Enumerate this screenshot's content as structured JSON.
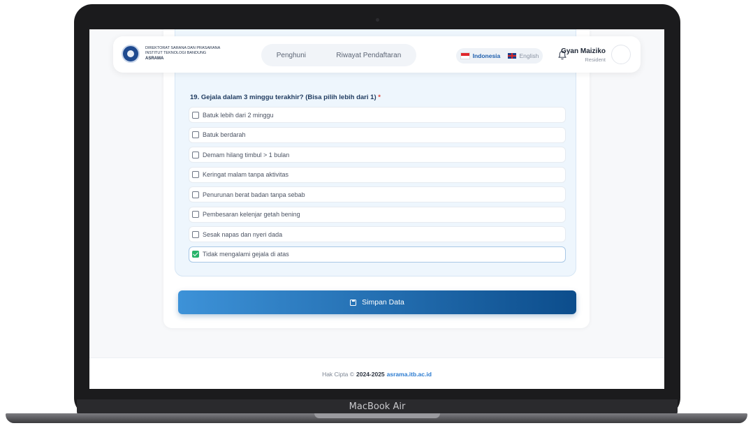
{
  "device": {
    "label": "MacBook Air"
  },
  "header": {
    "brand": [
      "DIREKTORAT SARANA DAN PRASARANA",
      "INSTITUT TEKNOLOGI BANDUNG",
      "ASRAMA"
    ],
    "nav": [
      "Penghuni",
      "Riwayat Pendaftaran"
    ],
    "languages": {
      "id": "Indonesia",
      "en": "English"
    },
    "user": {
      "name": "Gyan Maiziko",
      "role": "Resident"
    }
  },
  "form": {
    "question": "19. Gejala dalam 3 minggu terakhir? (Bisa pilih lebih dari 1)",
    "required_mark": "*",
    "options": [
      {
        "label": "Batuk lebih dari 2 minggu",
        "checked": false
      },
      {
        "label": "Batuk berdarah",
        "checked": false
      },
      {
        "label": "Demam hilang timbul > 1 bulan",
        "checked": false
      },
      {
        "label": "Keringat malam tanpa aktivitas",
        "checked": false
      },
      {
        "label": "Penurunan berat badan tanpa sebab",
        "checked": false
      },
      {
        "label": "Pembesaran kelenjar getah bening",
        "checked": false
      },
      {
        "label": "Sesak napas dan nyeri dada",
        "checked": false
      },
      {
        "label": "Tidak mengalami gejala di atas",
        "checked": true
      }
    ],
    "save_label": "Simpan Data"
  },
  "footer": {
    "prefix": "Hak Cipta ©",
    "years": "2024-2025",
    "site": "asrama.itb.ac.id"
  },
  "colors": {
    "accent": "#1f5fad",
    "check": "#28b46a",
    "button_start": "#3d92d8",
    "button_end": "#0c4d8c"
  },
  "icons": {
    "bell": "bell-icon",
    "save": "save-icon",
    "check": "checkmark-icon"
  }
}
